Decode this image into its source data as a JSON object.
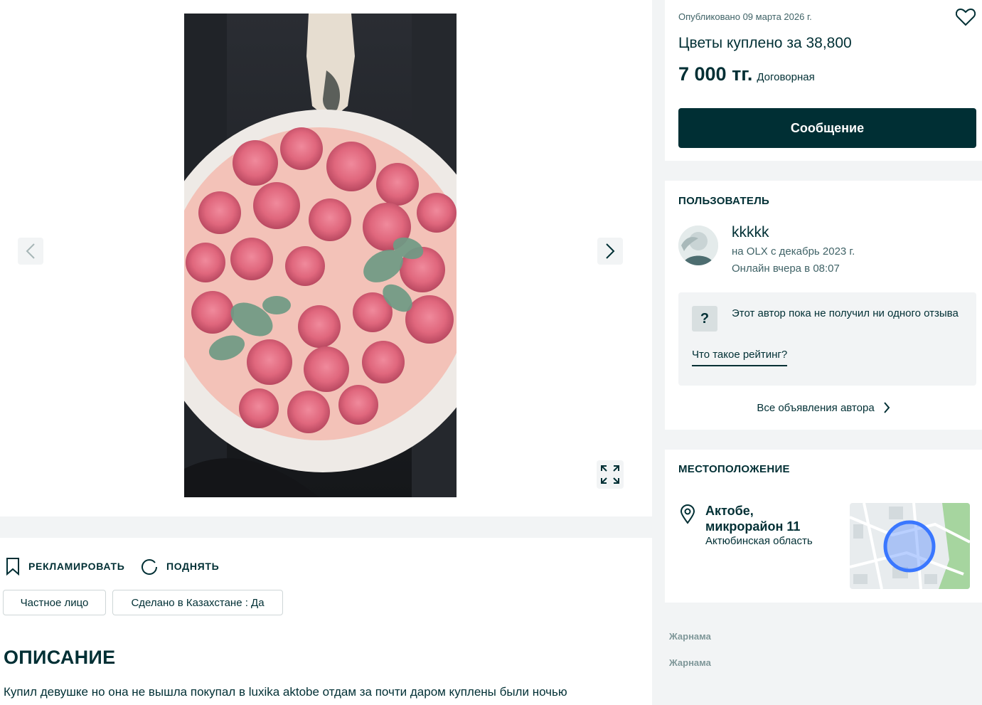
{
  "gallery": {
    "prev_icon": "chevron-left-icon",
    "next_icon": "chevron-right-icon",
    "fullscreen_icon": "expand-icon"
  },
  "actions": {
    "promote_label": "РЕКЛАМИРОВАТЬ",
    "promote_icon": "bookmark-icon",
    "raise_label": "ПОДНЯТЬ",
    "raise_icon": "refresh-icon"
  },
  "tags": [
    "Частное лицо",
    "Сделано в Казахстане : Да"
  ],
  "description": {
    "title": "ОПИСАНИЕ",
    "text": "Купил девушке но она не вышла покупал в luxika aktobe отдам за почти даром куплены были ночью"
  },
  "ad": {
    "published": "Опубликовано 09 марта 2026 г.",
    "title": "Цветы куплено за 38,800",
    "price": "7 000 тг.",
    "negotiable": "Договорная",
    "message_button": "Сообщение"
  },
  "user": {
    "section_title": "ПОЛЬЗОВАТЕЛЬ",
    "name": "kkkkk",
    "since": "на OLX с декабрь 2023 г.",
    "online": "Онлайн вчера в 08:07",
    "rating_badge": "?",
    "rating_text": "Этот автор пока не получил ни одного отзыва",
    "rating_link": "Что такое рейтинг?",
    "all_ads": "Все объявления автора"
  },
  "location": {
    "section_title": "МЕСТОПОЛОЖЕНИЕ",
    "city": "Актобе, микрорайон 11",
    "region": "Актюбинская область"
  },
  "ads": [
    "Жарнама",
    "Жарнама"
  ],
  "colors": {
    "primary": "#002f34",
    "background": "#f2f4f5",
    "map_marker": "#3a77ff"
  }
}
